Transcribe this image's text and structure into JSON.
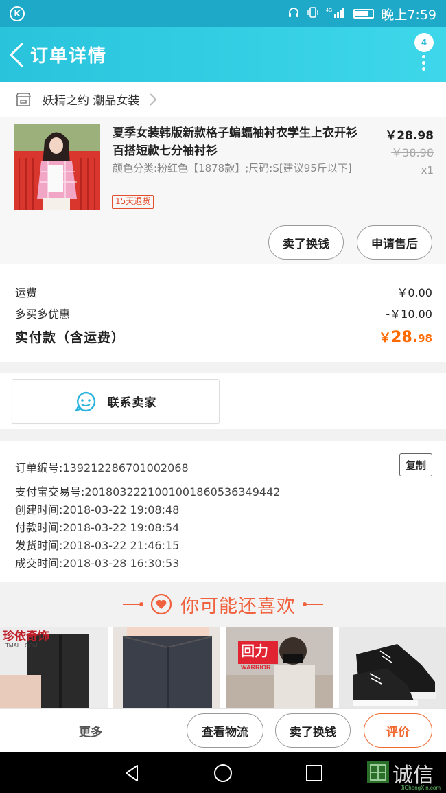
{
  "status_bar": {
    "time": "晚上7:59",
    "network": "4G"
  },
  "header": {
    "title": "订单详情",
    "badge_count": "4"
  },
  "shop": {
    "name": "妖精之约 潮品女装"
  },
  "product": {
    "title": "夏季女装韩版新款格子蝙蝠袖衬衣学生上衣开衫百搭短款七分袖衬衫",
    "spec": "颜色分类:粉红色【1878款】;尺码:S[建议95斤以下]",
    "refund_badge": "15天退货",
    "price": "￥28.98",
    "old_price": "￥38.98",
    "qty": "x1",
    "buttons": {
      "exchange": "卖了换钱",
      "after_sale": "申请售后"
    }
  },
  "totals": {
    "shipping_label": "运费",
    "shipping_value": "￥0.00",
    "discount_label": "多买多优惠",
    "discount_value": "-￥10.00",
    "paid_label": "实付款（含运费）",
    "paid_currency": "￥",
    "paid_int": "28.",
    "paid_dec": "98"
  },
  "contact": {
    "label": "联系卖家"
  },
  "order_info": {
    "copy_label": "复制",
    "rows": [
      {
        "label": "订单编号:",
        "value": "139212286701002068"
      },
      {
        "label": "支付宝交易号:",
        "value": "2018032221001001860536349442"
      },
      {
        "label": "创建时间:",
        "value": "2018-03-22 19:08:48"
      },
      {
        "label": "付款时间:",
        "value": "2018-03-22 19:08:54"
      },
      {
        "label": "发货时间:",
        "value": "2018-03-22 21:46:15"
      },
      {
        "label": "成交时间:",
        "value": "2018-03-28 16:30:53"
      }
    ]
  },
  "recommend": {
    "title": "你可能还喜欢",
    "items": [
      {
        "brand": "珍依奇饰",
        "sub": "TMALL.COM"
      },
      {
        "brand": "",
        "sub": ""
      },
      {
        "brand": "回力",
        "sub": "WARRIOR"
      },
      {
        "brand": "",
        "sub": ""
      }
    ]
  },
  "bottom_bar": {
    "more": "更多",
    "logistics": "查看物流",
    "exchange": "卖了换钱",
    "review": "评价"
  },
  "watermark": {
    "text": "诚信",
    "sub": "JiChengXin.com"
  },
  "colors": {
    "header": "#2ec7de",
    "accent_orange": "#ff6a00",
    "refund_red": "#e34f2f",
    "recommend_red": "#f0623d"
  }
}
